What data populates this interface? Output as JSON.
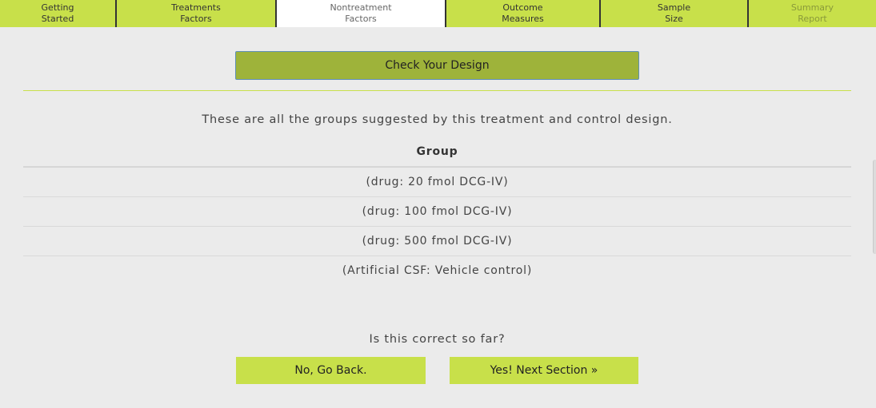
{
  "tabs": [
    {
      "label": "Getting\nStarted",
      "width": 146
    },
    {
      "label": "Treatments\nFactors",
      "width": 200
    },
    {
      "label": "Nontreatment\nFactors",
      "width": 212
    },
    {
      "label": "Outcome\nMeasures",
      "width": 193
    },
    {
      "label": "Sample\nSize",
      "width": 185
    },
    {
      "label": "Summary\nReport",
      "width": 159
    }
  ],
  "check_button": "Check Your Design",
  "intro_text": "These are all the groups suggested by this treatment and control design.",
  "table": {
    "header": "Group",
    "rows": [
      "(drug: 20 fmol DCG-IV)",
      "(drug: 100 fmol DCG-IV)",
      "(drug: 500 fmol DCG-IV)",
      "(Artificial CSF: Vehicle control)"
    ]
  },
  "question": "Is this correct so far?",
  "buttons": {
    "back": "No, Go Back.",
    "next": "Yes! Next Section »"
  }
}
